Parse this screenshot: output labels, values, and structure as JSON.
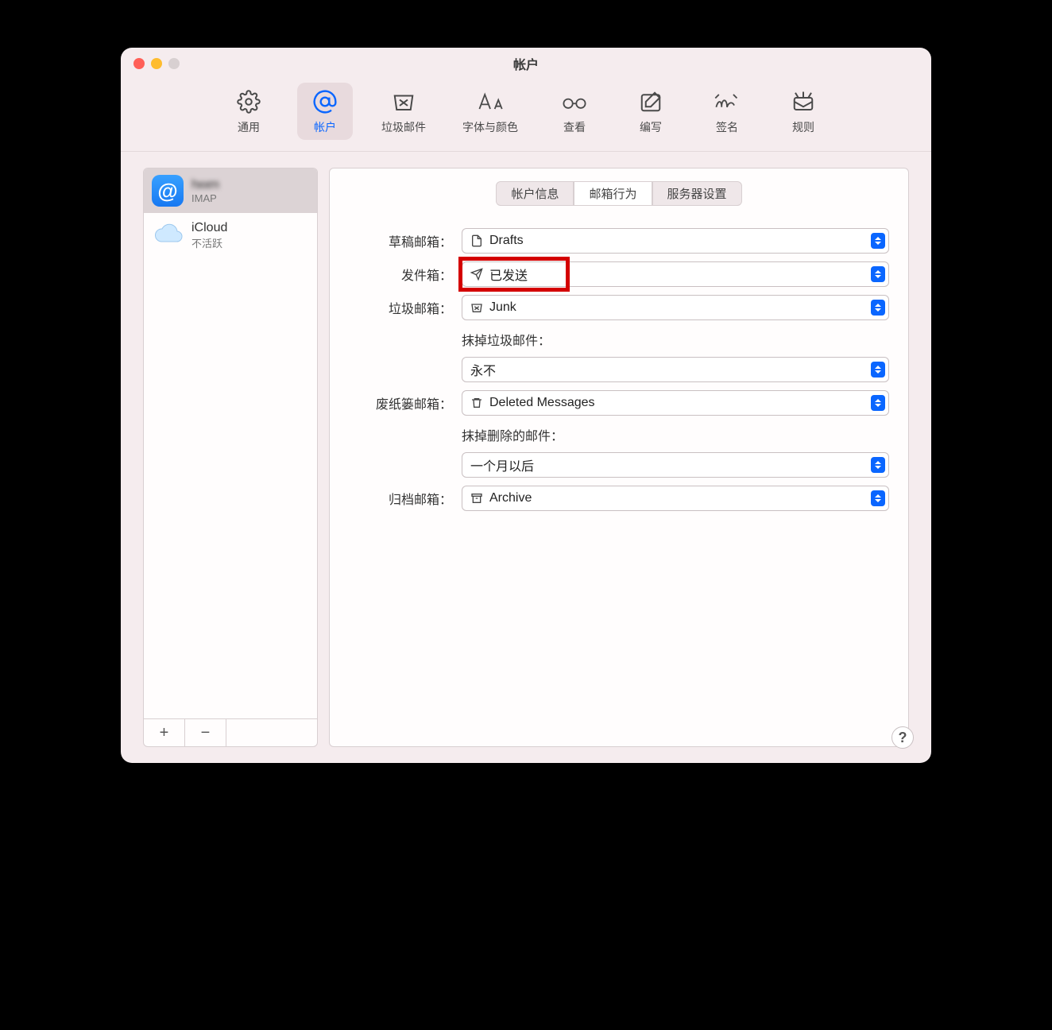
{
  "window": {
    "title": "帐户"
  },
  "toolbar": {
    "items": [
      {
        "id": "general",
        "label": "通用"
      },
      {
        "id": "accounts",
        "label": "帐户"
      },
      {
        "id": "junk",
        "label": "垃圾邮件"
      },
      {
        "id": "fonts",
        "label": "字体与颜色"
      },
      {
        "id": "viewing",
        "label": "查看"
      },
      {
        "id": "composing",
        "label": "编写"
      },
      {
        "id": "signatures",
        "label": "签名"
      },
      {
        "id": "rules",
        "label": "规则"
      }
    ]
  },
  "sidebar": {
    "accounts": [
      {
        "name": "[obscured]",
        "subtitle": "IMAP",
        "selected": true
      },
      {
        "name": "iCloud",
        "subtitle": "不活跃",
        "selected": false
      }
    ]
  },
  "tabs": {
    "items": [
      "帐户信息",
      "邮箱行为",
      "服务器设置"
    ],
    "active_index": 1
  },
  "form": {
    "drafts": {
      "label": "草稿邮箱：",
      "value": "Drafts"
    },
    "sent": {
      "label": "发件箱：",
      "value": "已发送"
    },
    "junk": {
      "label": "垃圾邮箱：",
      "value": "Junk"
    },
    "erase_junk_label": "抹掉垃圾邮件：",
    "erase_junk_value": "永不",
    "trash": {
      "label": "废纸篓邮箱：",
      "value": "Deleted Messages"
    },
    "erase_trash_label": "抹掉删除的邮件：",
    "erase_trash_value": "一个月以后",
    "archive": {
      "label": "归档邮箱：",
      "value": "Archive"
    }
  },
  "help": "?"
}
